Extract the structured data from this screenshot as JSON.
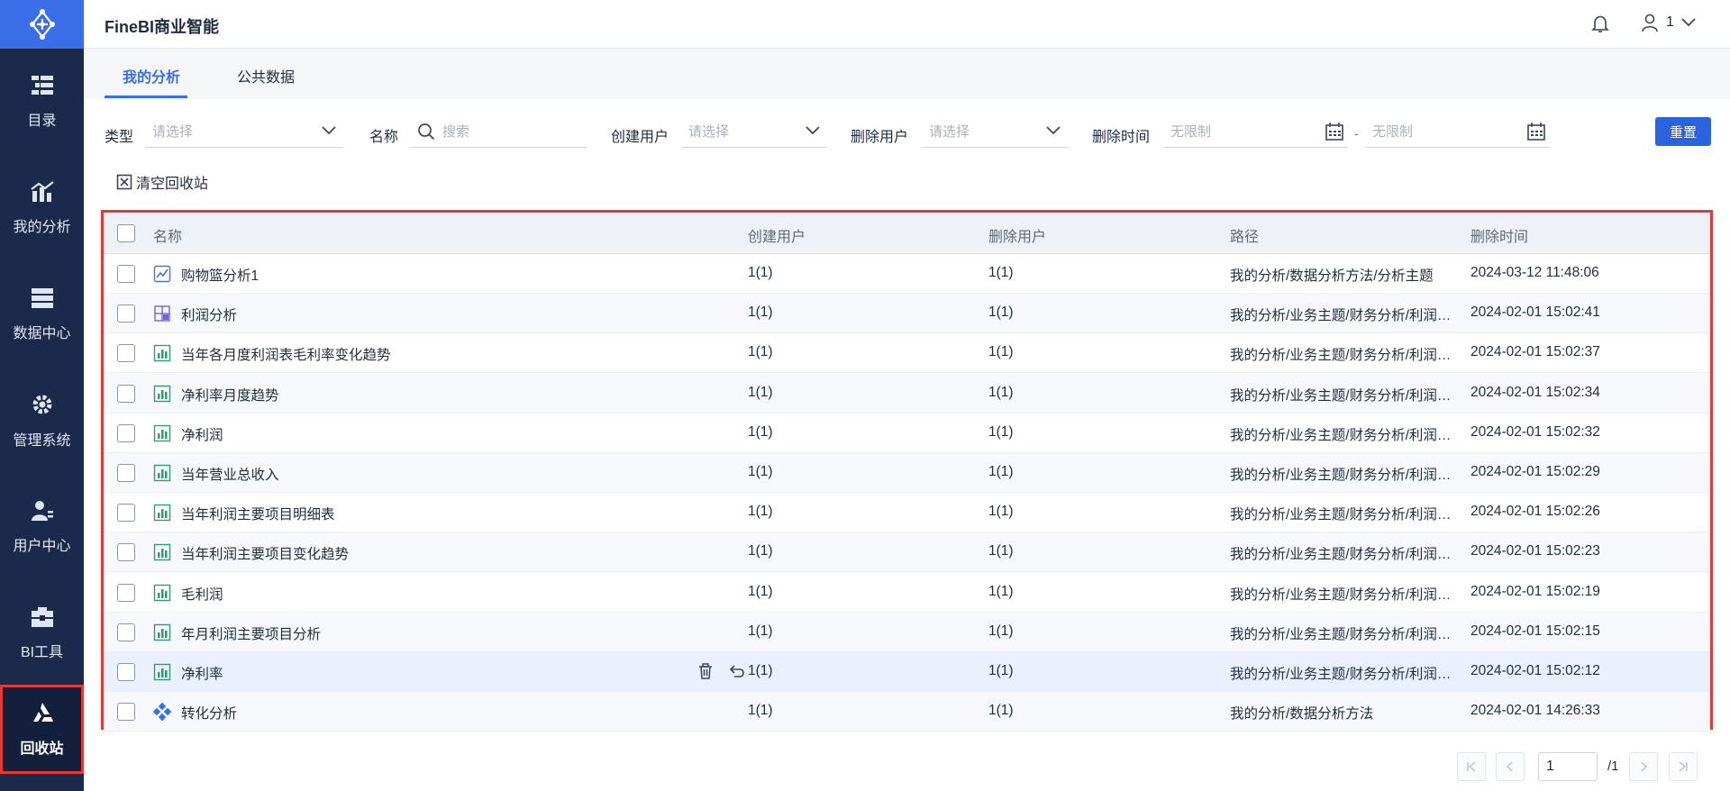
{
  "app": {
    "title": "FineBI商业智能"
  },
  "header": {
    "user_label": "1"
  },
  "sidebar": {
    "items": [
      {
        "label": "目录",
        "icon": "catalog-icon"
      },
      {
        "label": "我的分析",
        "icon": "analysis-icon"
      },
      {
        "label": "数据中心",
        "icon": "data-center-icon"
      },
      {
        "label": "管理系统",
        "icon": "gear-icon"
      },
      {
        "label": "用户中心",
        "icon": "user-center-icon"
      },
      {
        "label": "BI工具",
        "icon": "toolbox-icon"
      },
      {
        "label": "回收站",
        "icon": "recycle-icon",
        "active": true
      }
    ]
  },
  "tabs": [
    {
      "label": "我的分析",
      "active": true
    },
    {
      "label": "公共数据",
      "active": false
    }
  ],
  "filters": {
    "type_label": "类型",
    "type_placeholder": "请选择",
    "name_label": "名称",
    "name_placeholder": "搜索",
    "creator_label": "创建用户",
    "creator_placeholder": "请选择",
    "deleter_label": "删除用户",
    "deleter_placeholder": "请选择",
    "delete_time_label": "删除时间",
    "time_start_placeholder": "无限制",
    "time_separator": "-",
    "time_end_placeholder": "无限制",
    "reset_label": "重置"
  },
  "toolbar": {
    "clear_label": "清空回收站"
  },
  "table": {
    "columns": [
      "名称",
      "创建用户",
      "删除用户",
      "路径",
      "删除时间"
    ],
    "rows": [
      {
        "name": "购物篮分析1",
        "icon": "line-chart-icon",
        "creator": "1(1)",
        "deleter": "1(1)",
        "path": "我的分析/数据分析方法/分析主题",
        "time": "2024-03-12 11:48:06"
      },
      {
        "name": "利润分析",
        "icon": "dashboard-icon",
        "creator": "1(1)",
        "deleter": "1(1)",
        "path": "我的分析/业务主题/财务分析/利润…",
        "time": "2024-02-01 15:02:41"
      },
      {
        "name": "当年各月度利润表毛利率变化趋势",
        "icon": "bar-chart-icon",
        "creator": "1(1)",
        "deleter": "1(1)",
        "path": "我的分析/业务主题/财务分析/利润…",
        "time": "2024-02-01 15:02:37"
      },
      {
        "name": "净利率月度趋势",
        "icon": "bar-chart-icon",
        "creator": "1(1)",
        "deleter": "1(1)",
        "path": "我的分析/业务主题/财务分析/利润…",
        "time": "2024-02-01 15:02:34"
      },
      {
        "name": "净利润",
        "icon": "bar-chart-icon",
        "creator": "1(1)",
        "deleter": "1(1)",
        "path": "我的分析/业务主题/财务分析/利润…",
        "time": "2024-02-01 15:02:32"
      },
      {
        "name": "当年营业总收入",
        "icon": "bar-chart-icon",
        "creator": "1(1)",
        "deleter": "1(1)",
        "path": "我的分析/业务主题/财务分析/利润…",
        "time": "2024-02-01 15:02:29"
      },
      {
        "name": "当年利润主要项目明细表",
        "icon": "bar-chart-icon",
        "creator": "1(1)",
        "deleter": "1(1)",
        "path": "我的分析/业务主题/财务分析/利润…",
        "time": "2024-02-01 15:02:26"
      },
      {
        "name": "当年利润主要项目变化趋势",
        "icon": "bar-chart-icon",
        "creator": "1(1)",
        "deleter": "1(1)",
        "path": "我的分析/业务主题/财务分析/利润…",
        "time": "2024-02-01 15:02:23"
      },
      {
        "name": "毛利润",
        "icon": "bar-chart-icon",
        "creator": "1(1)",
        "deleter": "1(1)",
        "path": "我的分析/业务主题/财务分析/利润…",
        "time": "2024-02-01 15:02:19"
      },
      {
        "name": "年月利润主要项目分析",
        "icon": "bar-chart-icon",
        "creator": "1(1)",
        "deleter": "1(1)",
        "path": "我的分析/业务主题/财务分析/利润…",
        "time": "2024-02-01 15:02:15"
      },
      {
        "name": "净利率",
        "icon": "bar-chart-icon",
        "creator": "1(1)",
        "deleter": "1(1)",
        "path": "我的分析/业务主题/财务分析/利润…",
        "time": "2024-02-01 15:02:12",
        "hover": true
      },
      {
        "name": "转化分析",
        "icon": "diamond-icon",
        "creator": "1(1)",
        "deleter": "1(1)",
        "path": "我的分析/数据分析方法",
        "time": "2024-02-01 14:26:33"
      }
    ]
  },
  "pagination": {
    "current_page": "1",
    "total_label": "/1"
  },
  "colors": {
    "accent": "#3a6ee8",
    "sidebar": "#1b2a4a",
    "highlight": "#e53935"
  }
}
